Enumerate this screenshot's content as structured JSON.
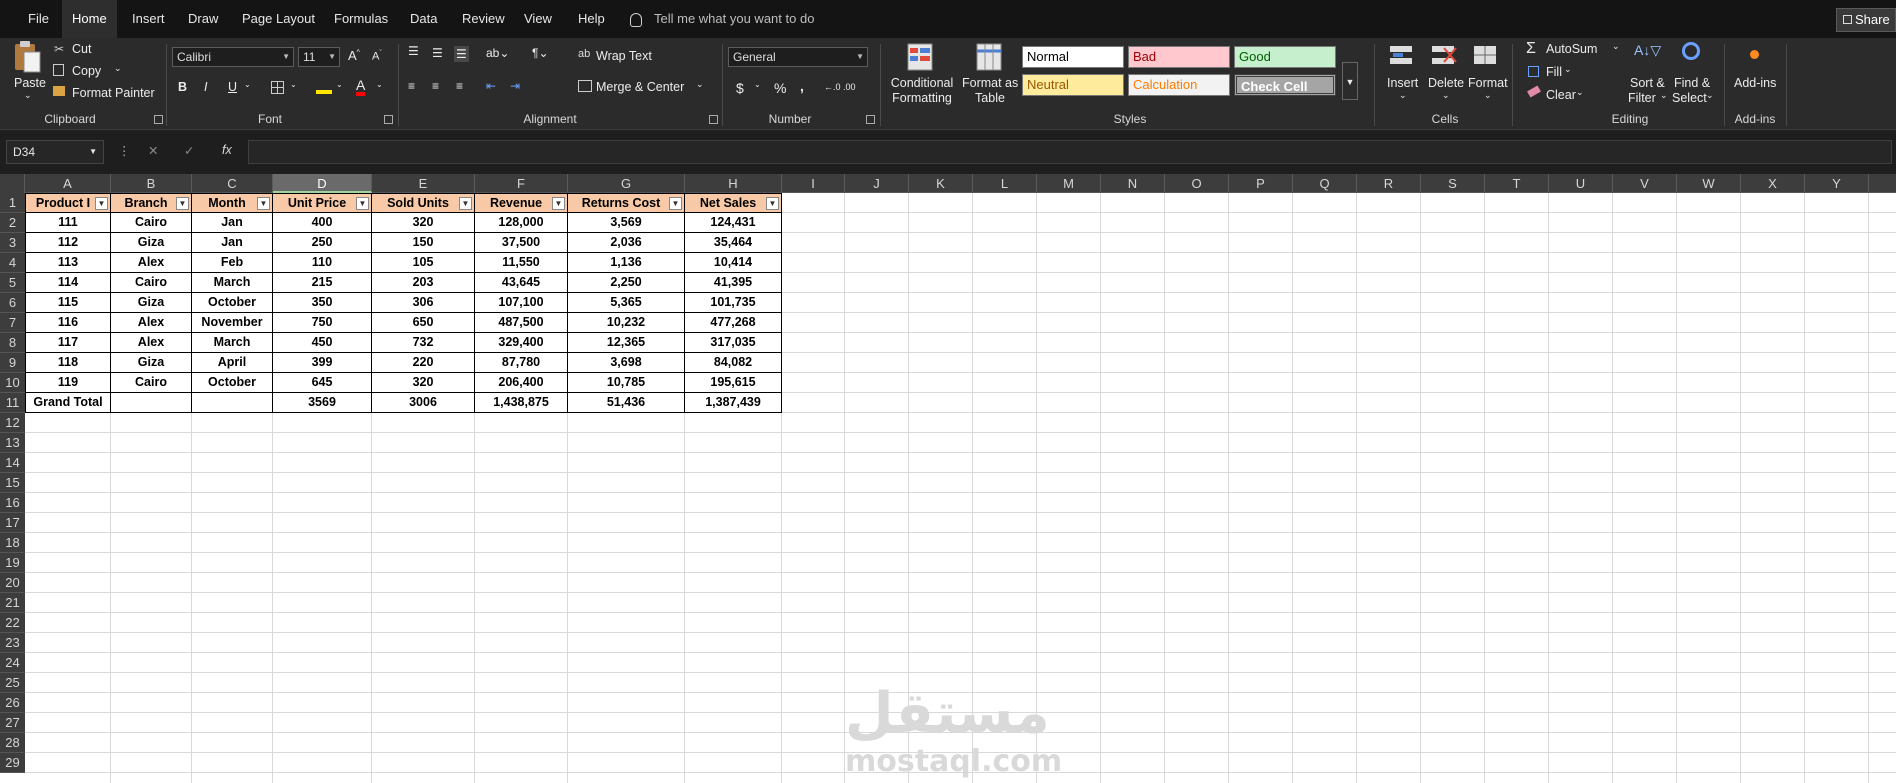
{
  "menu": {
    "tabs": [
      "File",
      "Home",
      "Insert",
      "Draw",
      "Page Layout",
      "Formulas",
      "Data",
      "Review",
      "View",
      "Help"
    ],
    "active": "Home",
    "tell_me": "Tell me what you want to do",
    "share": "Share"
  },
  "ribbon": {
    "clipboard": {
      "paste": "Paste",
      "cut": "Cut",
      "copy": "Copy",
      "format_painter": "Format Painter",
      "label": "Clipboard"
    },
    "font": {
      "name": "Calibri",
      "size": "11",
      "bold": "B",
      "italic": "I",
      "underline": "U",
      "label": "Font"
    },
    "alignment": {
      "wrap_text": "Wrap Text",
      "merge_center": "Merge & Center",
      "label": "Alignment"
    },
    "number": {
      "format": "General",
      "currency": "$",
      "percent": "%",
      "comma": ",",
      "label": "Number"
    },
    "styles": {
      "conditional_formatting": [
        "Conditional",
        "Formatting"
      ],
      "format_as_table": [
        "Format as",
        "Table"
      ],
      "cells": [
        "Normal",
        "Bad",
        "Good",
        "Neutral",
        "Calculation",
        "Check Cell"
      ],
      "label": "Styles"
    },
    "cells": {
      "insert": "Insert",
      "delete": "Delete",
      "format": "Format",
      "label": "Cells"
    },
    "editing": {
      "autosum": "AutoSum",
      "fill": "Fill",
      "clear": "Clear",
      "sort_filter": [
        "Sort &",
        "Filter"
      ],
      "find_select": [
        "Find &",
        "Select"
      ],
      "label": "Editing"
    },
    "addins": {
      "addins": "Add-ins",
      "label": "Add-ins"
    }
  },
  "formula_bar": {
    "name_box": "D34",
    "cancel": "✕",
    "enter": "✓",
    "fx": "fx",
    "content": ""
  },
  "columns": [
    "A",
    "B",
    "C",
    "D",
    "E",
    "F",
    "G",
    "H",
    "I",
    "J",
    "K",
    "L",
    "M",
    "N",
    "O",
    "P",
    "Q",
    "R",
    "S",
    "T",
    "U",
    "V",
    "W",
    "X",
    "Y"
  ],
  "selected_column": "D",
  "rows": [
    "1",
    "2",
    "3",
    "4",
    "5",
    "6",
    "7",
    "8",
    "9",
    "10",
    "11",
    "12",
    "13",
    "14",
    "15",
    "16",
    "17",
    "18",
    "19",
    "20",
    "21",
    "22",
    "23",
    "24",
    "25",
    "26",
    "27",
    "28",
    "29"
  ],
  "table": {
    "headers": [
      "Product I",
      "Branch",
      "Month",
      "Unit Price",
      "Sold Units",
      "Revenue",
      "Returns Cost",
      "Net Sales"
    ],
    "rows": [
      [
        "111",
        "Cairo",
        "Jan",
        "400",
        "320",
        "128,000",
        "3,569",
        "124,431"
      ],
      [
        "112",
        "Giza",
        "Jan",
        "250",
        "150",
        "37,500",
        "2,036",
        "35,464"
      ],
      [
        "113",
        "Alex",
        "Feb",
        "110",
        "105",
        "11,550",
        "1,136",
        "10,414"
      ],
      [
        "114",
        "Cairo",
        "March",
        "215",
        "203",
        "43,645",
        "2,250",
        "41,395"
      ],
      [
        "115",
        "Giza",
        "October",
        "350",
        "306",
        "107,100",
        "5,365",
        "101,735"
      ],
      [
        "116",
        "Alex",
        "November",
        "750",
        "650",
        "487,500",
        "10,232",
        "477,268"
      ],
      [
        "117",
        "Alex",
        "March",
        "450",
        "732",
        "329,400",
        "12,365",
        "317,035"
      ],
      [
        "118",
        "Giza",
        "April",
        "399",
        "220",
        "87,780",
        "3,698",
        "84,082"
      ],
      [
        "119",
        "Cairo",
        "October",
        "645",
        "320",
        "206,400",
        "10,785",
        "195,615"
      ]
    ],
    "total": [
      "Grand Total",
      "",
      "",
      "3569",
      "3006",
      "1,438,875",
      "51,436",
      "1,387,439"
    ]
  },
  "watermark": {
    "arabic": "مستقل",
    "latin": "mostaql.com"
  },
  "colors": {
    "header_fill": "#f7c9a6",
    "ribbon_bg": "#2b2b2b",
    "menu_bg": "#141414"
  }
}
